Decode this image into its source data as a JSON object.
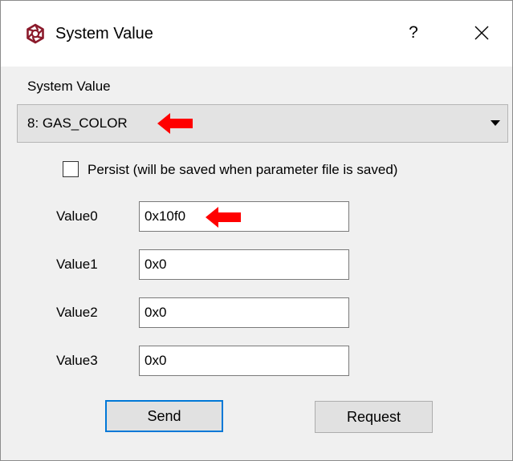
{
  "window": {
    "title": "System Value",
    "app_icon": "gear-app-icon",
    "help_label": "?",
    "close_icon": "close-icon"
  },
  "system_value": {
    "label": "System Value",
    "selected": "8: GAS_COLOR"
  },
  "persist": {
    "checked": false,
    "label": "Persist (will be saved when parameter file is saved)"
  },
  "values": [
    {
      "label": "Value0",
      "value": "0x10f0"
    },
    {
      "label": "Value1",
      "value": "0x0"
    },
    {
      "label": "Value2",
      "value": "0x0"
    },
    {
      "label": "Value3",
      "value": "0x0"
    }
  ],
  "buttons": {
    "send": "Send",
    "request": "Request"
  },
  "colors": {
    "annotation_arrow": "#ff0000",
    "focus_border": "#0078d7",
    "app_icon": "#8b1a2b"
  }
}
